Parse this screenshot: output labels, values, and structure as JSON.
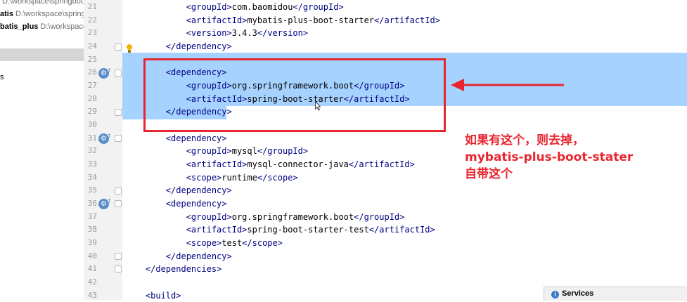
{
  "project_panel": {
    "rows": [
      {
        "name": "",
        "path": "D:\\workspace\\springboo"
      },
      {
        "name": "atis",
        "path": "D:\\workspace\\spring"
      },
      {
        "name": "batis_plus",
        "path": "D:\\workspace\\s"
      }
    ],
    "stub_text": "s"
  },
  "gutter": {
    "line_numbers": [
      "21",
      "22",
      "23",
      "24",
      "25",
      "26",
      "27",
      "28",
      "29",
      "30",
      "31",
      "32",
      "33",
      "34",
      "35",
      "36",
      "37",
      "38",
      "39",
      "40",
      "41",
      "42",
      "43"
    ],
    "run_icon": "run-dependency-icon",
    "bulb_icon": "lightbulb-icon"
  },
  "editor": {
    "lines": [
      {
        "indent": "            ",
        "tag": "groupId",
        "text": "com.baomidou"
      },
      {
        "indent": "            ",
        "tag": "artifactId",
        "text": "mybatis-plus-boot-starter"
      },
      {
        "indent": "            ",
        "tag": "version",
        "text": "3.4.3"
      },
      {
        "indent": "        ",
        "close": "dependency"
      },
      {
        "indent": "",
        "empty": true
      },
      {
        "indent": "        ",
        "open": "dependency"
      },
      {
        "indent": "            ",
        "tag": "groupId",
        "text": "org.springframework.boot"
      },
      {
        "indent": "            ",
        "tag": "artifactId",
        "text": "spring-boot-starter"
      },
      {
        "indent": "        ",
        "close": "dependency"
      },
      {
        "indent": "",
        "empty": true
      },
      {
        "indent": "        ",
        "open": "dependency"
      },
      {
        "indent": "            ",
        "tag": "groupId",
        "text": "mysql"
      },
      {
        "indent": "            ",
        "tag": "artifactId",
        "text": "mysql-connector-java"
      },
      {
        "indent": "            ",
        "tag": "scope",
        "text": "runtime"
      },
      {
        "indent": "        ",
        "close": "dependency"
      },
      {
        "indent": "        ",
        "open": "dependency"
      },
      {
        "indent": "            ",
        "tag": "groupId",
        "text": "org.springframework.boot"
      },
      {
        "indent": "            ",
        "tag": "artifactId",
        "text": "spring-boot-starter-test"
      },
      {
        "indent": "            ",
        "tag": "scope",
        "text": "test"
      },
      {
        "indent": "        ",
        "close": "dependency"
      },
      {
        "indent": "    ",
        "close": "dependencies"
      },
      {
        "indent": "",
        "empty": true
      },
      {
        "indent": "    ",
        "open": "build"
      }
    ]
  },
  "annotation": {
    "lines": [
      "如果有这个，则去掉，",
      "mybatis-plus-boot-stater",
      "自带这个"
    ],
    "color": "#e8262f"
  },
  "services_panel": {
    "label": "Services"
  },
  "colors": {
    "tag": "#000080",
    "selection": "#a6d2ff",
    "gutter_bg": "#f2f2f2",
    "line_number": "#999999"
  }
}
